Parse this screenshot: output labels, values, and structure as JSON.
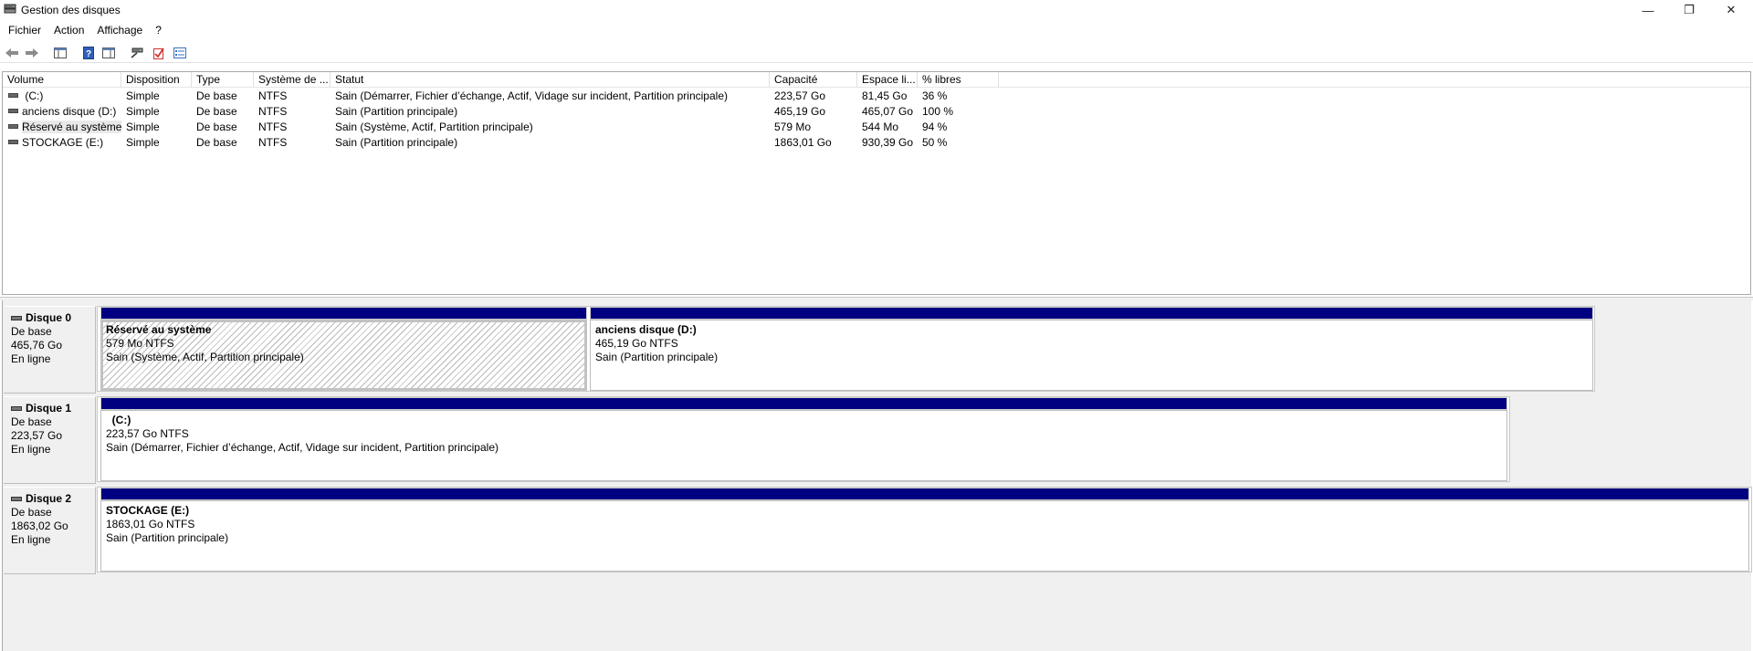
{
  "window": {
    "title": "Gestion des disques",
    "min_glyph": "—",
    "max_glyph": "❐",
    "close_glyph": "✕"
  },
  "menu": [
    "Fichier",
    "Action",
    "Affichage",
    "?"
  ],
  "toolbar_icons": [
    "back-arrow-icon",
    "forward-arrow-icon",
    "console-tree-icon",
    "help-icon",
    "properties-icon",
    "connect-icon",
    "check-icon",
    "list-icon"
  ],
  "volume_list": {
    "columns": [
      "Volume",
      "Disposition",
      "Type",
      "Système de ...",
      "Statut",
      "Capacité",
      "Espace li...",
      "% libres"
    ],
    "rows": [
      {
        "volume": " (C:)",
        "disposition": "Simple",
        "type": "De base",
        "fs": "NTFS",
        "status": "Sain (Démarrer, Fichier d’échange, Actif, Vidage sur incident, Partition principale)",
        "capacity": "223,57 Go",
        "free": "81,45 Go",
        "pct": "36 %"
      },
      {
        "volume": "anciens disque (D:)",
        "disposition": "Simple",
        "type": "De base",
        "fs": "NTFS",
        "status": "Sain (Partition principale)",
        "capacity": "465,19 Go",
        "free": "465,07 Go",
        "pct": "100 %"
      },
      {
        "volume": "Réservé au système",
        "disposition": "Simple",
        "type": "De base",
        "fs": "NTFS",
        "status": "Sain (Système, Actif, Partition principale)",
        "capacity": "579 Mo",
        "free": "544 Mo",
        "pct": "94 %"
      },
      {
        "volume": "STOCKAGE (E:)",
        "disposition": "Simple",
        "type": "De base",
        "fs": "NTFS",
        "status": "Sain (Partition principale)",
        "capacity": "1863,01 Go",
        "free": "930,39 Go",
        "pct": "50 %"
      }
    ]
  },
  "disks": [
    {
      "name": "Disque 0",
      "type": "De base",
      "size": "465,76 Go",
      "state": "En ligne",
      "partitions": [
        {
          "name": "Réservé au système",
          "size_fs": "579 Mo NTFS",
          "status": "Sain (Système, Actif, Partition principale)"
        },
        {
          "name": "anciens disque  (D:)",
          "size_fs": "465,19 Go NTFS",
          "status": "Sain (Partition principale)"
        }
      ]
    },
    {
      "name": "Disque 1",
      "type": "De base",
      "size": "223,57 Go",
      "state": "En ligne",
      "partitions": [
        {
          "name": "  (C:)",
          "size_fs": "223,57 Go NTFS",
          "status": "Sain (Démarrer, Fichier d’échange, Actif, Vidage sur incident, Partition principale)"
        }
      ]
    },
    {
      "name": "Disque 2",
      "type": "De base",
      "size": "1863,02 Go",
      "state": "En ligne",
      "partitions": [
        {
          "name": "STOCKAGE  (E:)",
          "size_fs": "1863,01 Go NTFS",
          "status": "Sain (Partition principale)"
        }
      ]
    }
  ],
  "colors": {
    "partition_bar": "#000080",
    "hatch": "#b9b9b9",
    "pane_background": "#f0f0f0"
  }
}
